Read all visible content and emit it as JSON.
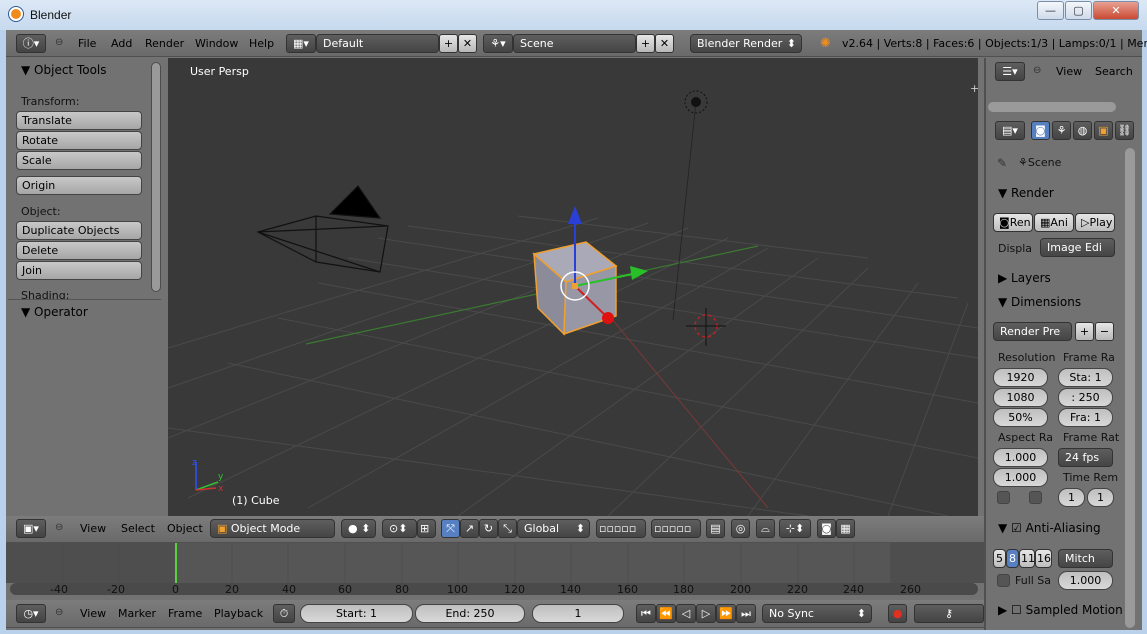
{
  "window": {
    "title": "Blender",
    "min": "—",
    "max": "▢",
    "close": "✕"
  },
  "info_header": {
    "menus": [
      "File",
      "Add",
      "Render",
      "Window",
      "Help"
    ],
    "screen": "Default",
    "scene": "Scene",
    "engine": "Blender Render",
    "stats": "v2.64 | Verts:8 | Faces:6 | Objects:1/3 | Lamps:0/1 | Mem:7"
  },
  "toolshelf": {
    "object_tools": "Object Tools",
    "transform_label": "Transform:",
    "translate": "Translate",
    "rotate": "Rotate",
    "scale": "Scale",
    "origin": "Origin",
    "object_label": "Object:",
    "duplicate": "Duplicate Objects",
    "delete": "Delete",
    "join": "Join",
    "shading_label": "Shading:",
    "operator": "Operator"
  },
  "viewport": {
    "view_name": "User Persp",
    "object_info": "(1) Cube",
    "axis_y": "y",
    "axis_z": "z",
    "axis_x": "x"
  },
  "view3d_header": {
    "menus": [
      "View",
      "Select",
      "Object"
    ],
    "mode": "Object Mode",
    "orientation": "Global"
  },
  "timeline": {
    "ruler_ticks": [
      "-40",
      "-20",
      "0",
      "20",
      "40",
      "60",
      "80",
      "100",
      "120",
      "140",
      "160",
      "180",
      "200",
      "220",
      "240",
      "260"
    ],
    "menus": [
      "View",
      "Marker",
      "Frame",
      "Playback"
    ],
    "start": "Start: 1",
    "end": "End: 250",
    "current": "1",
    "sync": "No Sync"
  },
  "outliner": {
    "view": "View",
    "search": "Search"
  },
  "properties": {
    "scene": "Scene",
    "render_panel": "Render",
    "render_btn": "Ren",
    "anim_btn": "Ani",
    "play_btn": "Play",
    "display_label": "Displa",
    "display_value": "Image Edi",
    "layers_panel": "Layers",
    "dimensions_panel": "Dimensions",
    "render_presets": "Render Pre",
    "resolution_label": "Resolution",
    "res_x": "1920",
    "res_y": "1080",
    "res_pct": "50%",
    "frame_range_label": "Frame Ra",
    "frame_start": "Sta: 1",
    "frame_end": ": 250",
    "frame_step": "Fra: 1",
    "aspect_label": "Aspect Ra",
    "aspect_x": "1.000",
    "aspect_y": "1.000",
    "frame_rate_label": "Frame Rat",
    "fps": "24 fps",
    "time_remap_label": "Time Rem",
    "time_old": "1",
    "time_new": "1",
    "aa_panel": "Anti-Aliasing",
    "aa_5": "5",
    "aa_8": "8",
    "aa_11": "11",
    "aa_16": "16",
    "aa_filter": "Mitch",
    "full_sample": "Full Sa",
    "filter_size": "1.000",
    "sampled_motion": "Sampled Motion"
  },
  "colors": {
    "accent": "#f08c1e",
    "selected_blue": "#5680c2"
  }
}
